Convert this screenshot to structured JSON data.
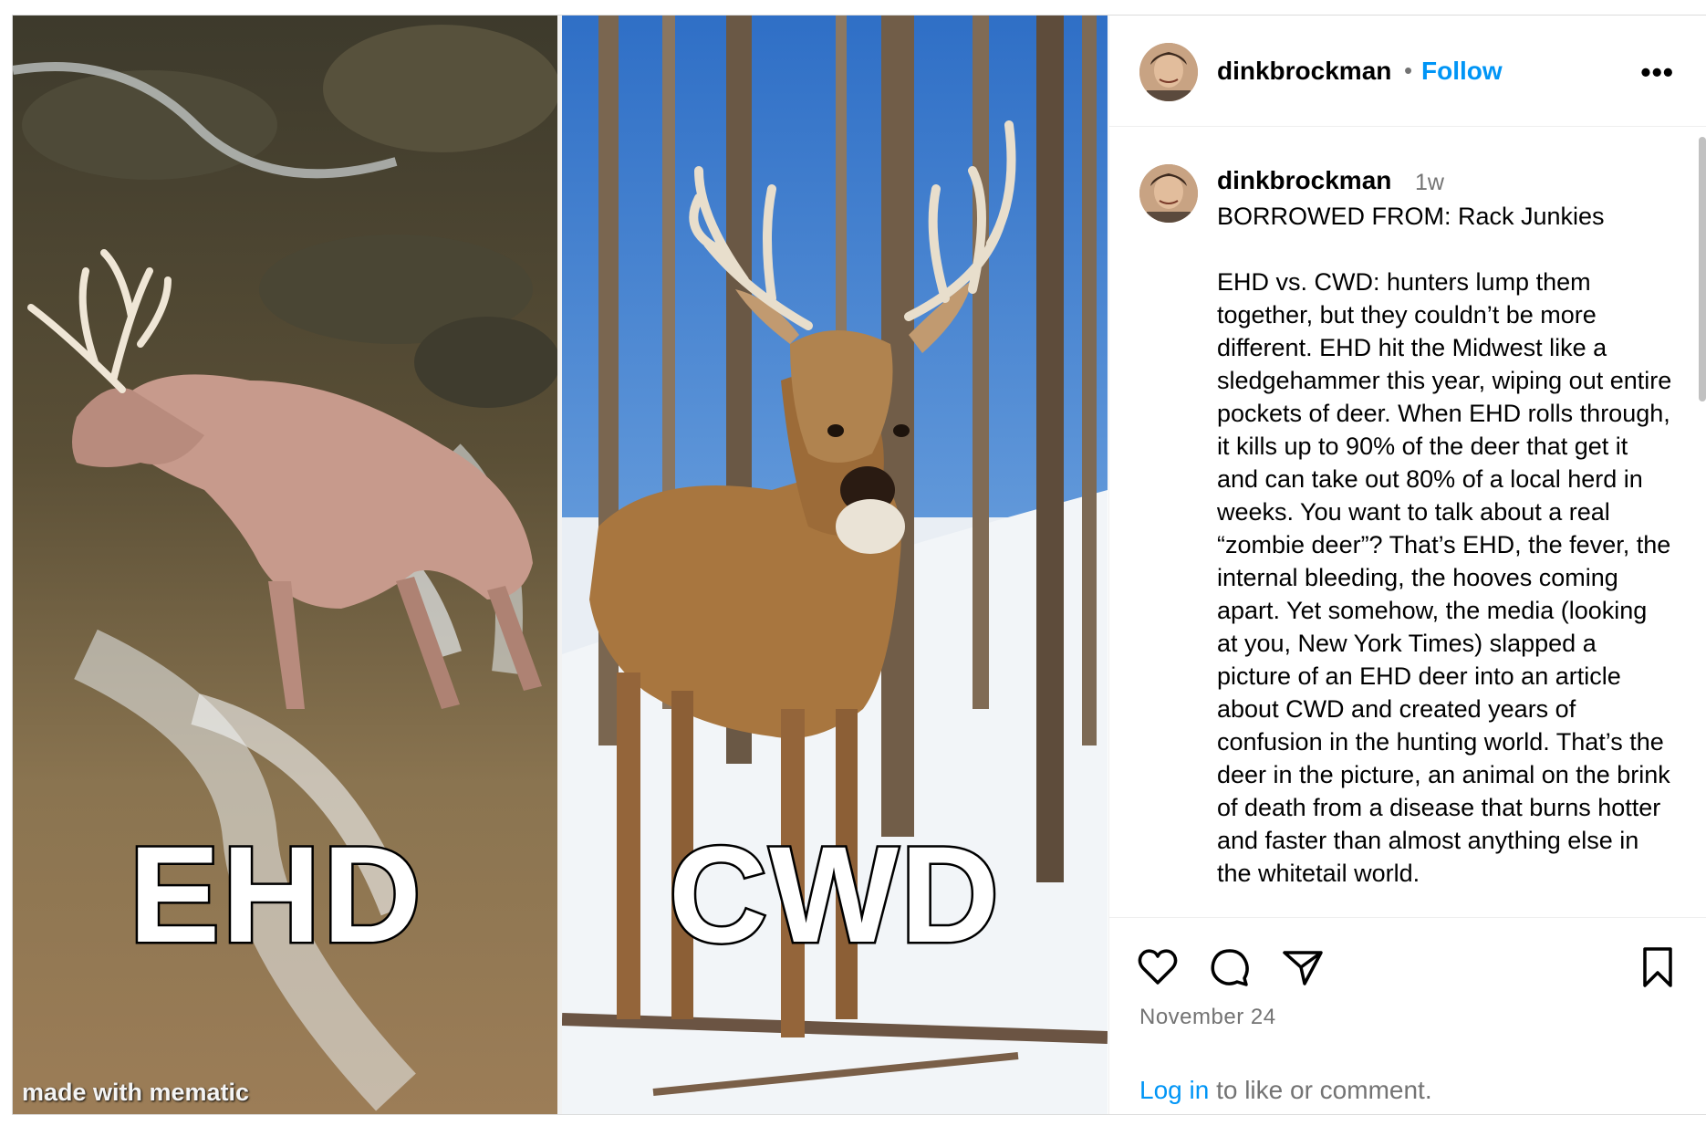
{
  "post": {
    "image_overlays": {
      "left_label": "EHD",
      "right_label": "CWD",
      "watermark": "made with mematic"
    },
    "header": {
      "username": "dinkbrockman",
      "separator": "•",
      "follow_label": "Follow",
      "more_icon": "more-options-icon",
      "more_glyph": "•••"
    },
    "caption": {
      "username": "dinkbrockman",
      "time": "1w",
      "first_line": "BORROWED FROM: Rack Junkies",
      "body": "EHD vs. CWD: hunters lump them together, but they couldn’t be more different. EHD hit the Midwest like a sledgehammer this year, wiping out entire pockets of deer. When EHD rolls through, it kills up to 90% of the deer that get it and can take out 80% of a local herd in weeks. You want to talk about a real “zombie deer”? That’s EHD, the fever, the internal bleeding, the hooves coming apart. Yet somehow, the media (looking at you, New York Times) slapped a picture of an EHD deer into an article about CWD and created years of confusion in the hunting world. That’s the deer in the picture, an animal on the brink of death from a disease that burns hotter and faster than almost anything else in the whitetail world."
    },
    "actions": {
      "icons": [
        "heart-icon",
        "comment-icon",
        "share-icon",
        "bookmark-icon"
      ],
      "date": "November 24",
      "login_link": "Log in",
      "login_suffix": " to like or comment."
    },
    "colors": {
      "link_blue": "#0095f6",
      "muted_gray": "#737373",
      "border": "#efefef"
    }
  }
}
